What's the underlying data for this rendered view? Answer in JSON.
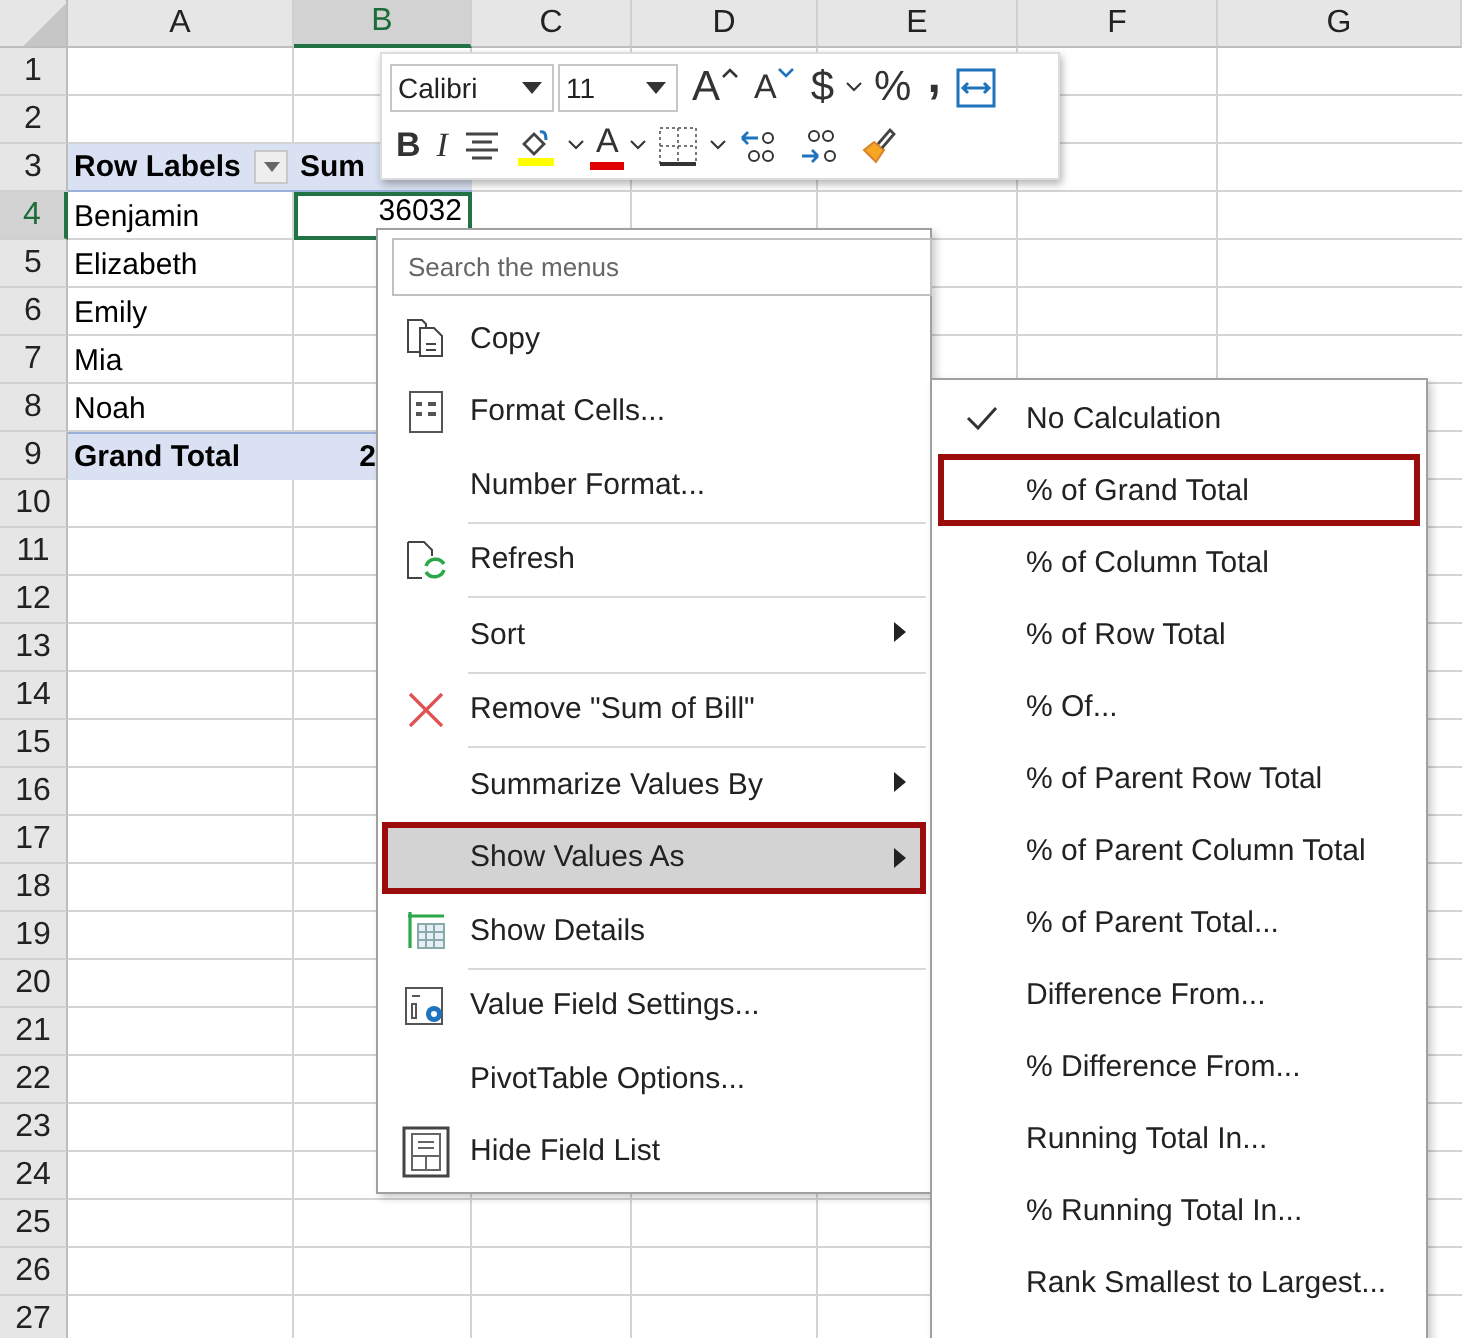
{
  "columns": [
    {
      "label": "A",
      "selected": false
    },
    {
      "label": "B",
      "selected": true
    },
    {
      "label": "C",
      "selected": false
    },
    {
      "label": "D",
      "selected": false
    },
    {
      "label": "E",
      "selected": false
    },
    {
      "label": "F",
      "selected": false
    },
    {
      "label": "G",
      "selected": false
    }
  ],
  "rows": [
    {
      "number": "1",
      "selected": false,
      "kind": "blank"
    },
    {
      "number": "2",
      "selected": false,
      "kind": "blank"
    },
    {
      "number": "3",
      "selected": false,
      "kind": "header",
      "label": "Row Labels",
      "value": "Sum"
    },
    {
      "number": "4",
      "selected": true,
      "kind": "item",
      "label": "Benjamin",
      "value": "36032"
    },
    {
      "number": "5",
      "selected": false,
      "kind": "item",
      "label": "Elizabeth"
    },
    {
      "number": "6",
      "selected": false,
      "kind": "item",
      "label": "Emily"
    },
    {
      "number": "7",
      "selected": false,
      "kind": "item",
      "label": "Mia"
    },
    {
      "number": "8",
      "selected": false,
      "kind": "item",
      "label": "Noah"
    },
    {
      "number": "9",
      "selected": false,
      "kind": "total",
      "label": "Grand Total",
      "value": "2"
    },
    {
      "number": "10",
      "selected": false,
      "kind": "blank"
    },
    {
      "number": "11",
      "selected": false,
      "kind": "blank"
    },
    {
      "number": "12",
      "selected": false,
      "kind": "blank"
    },
    {
      "number": "13",
      "selected": false,
      "kind": "blank"
    },
    {
      "number": "14",
      "selected": false,
      "kind": "blank"
    },
    {
      "number": "15",
      "selected": false,
      "kind": "blank"
    },
    {
      "number": "16",
      "selected": false,
      "kind": "blank"
    },
    {
      "number": "17",
      "selected": false,
      "kind": "blank"
    },
    {
      "number": "18",
      "selected": false,
      "kind": "blank"
    },
    {
      "number": "19",
      "selected": false,
      "kind": "blank"
    },
    {
      "number": "20",
      "selected": false,
      "kind": "blank"
    },
    {
      "number": "21",
      "selected": false,
      "kind": "blank"
    },
    {
      "number": "22",
      "selected": false,
      "kind": "blank"
    },
    {
      "number": "23",
      "selected": false,
      "kind": "blank"
    },
    {
      "number": "24",
      "selected": false,
      "kind": "blank"
    },
    {
      "number": "25",
      "selected": false,
      "kind": "blank"
    },
    {
      "number": "26",
      "selected": false,
      "kind": "blank"
    },
    {
      "number": "27",
      "selected": false,
      "kind": "blank"
    }
  ],
  "mini_toolbar": {
    "font": "Calibri",
    "size": "11",
    "row_1": [
      {
        "kind": "grow",
        "glyph": "A"
      },
      {
        "kind": "shrink",
        "glyph": "A"
      },
      {
        "kind": "currency",
        "glyph": "$"
      },
      {
        "kind": "percent",
        "glyph": "%"
      },
      {
        "kind": "comma",
        "glyph": ","
      },
      {
        "kind": "wrap"
      }
    ],
    "row_2": [
      {
        "kind": "bold",
        "glyph": "B"
      },
      {
        "kind": "italic",
        "glyph": "I"
      },
      {
        "kind": "align"
      },
      {
        "kind": "fill"
      },
      {
        "kind": "fontcolor",
        "glyph": "A"
      },
      {
        "kind": "borders"
      },
      {
        "kind": "increase"
      },
      {
        "kind": "decrease"
      },
      {
        "kind": "painter"
      }
    ]
  },
  "context_menu": {
    "search": {
      "placeholder": "Search the menus"
    },
    "items": [
      {
        "label": "Copy",
        "kind": "copy",
        "divider_before": false,
        "submenu": false,
        "selected": false
      },
      {
        "label": "Format Cells...",
        "kind": "format",
        "divider_before": false,
        "submenu": false,
        "selected": false
      },
      {
        "label": "Number Format...",
        "kind": "none",
        "divider_before": false,
        "submenu": false,
        "selected": false
      },
      {
        "label": "Refresh",
        "kind": "refresh",
        "divider_before": true,
        "submenu": false,
        "selected": false
      },
      {
        "label": "Sort",
        "kind": "none",
        "divider_before": true,
        "submenu": true,
        "selected": false
      },
      {
        "label": "Remove \"Sum of Bill\"",
        "kind": "remove",
        "divider_before": true,
        "submenu": false,
        "selected": false
      },
      {
        "label": "Summarize Values By",
        "kind": "none",
        "divider_before": true,
        "submenu": true,
        "selected": false
      },
      {
        "label": "Show Values As",
        "kind": "none",
        "divider_before": false,
        "submenu": true,
        "selected": true
      },
      {
        "label": "Show Details",
        "kind": "details",
        "divider_before": false,
        "submenu": false,
        "selected": false
      },
      {
        "label": "Value Field Settings...",
        "kind": "settings",
        "divider_before": true,
        "submenu": false,
        "selected": false
      },
      {
        "label": "PivotTable Options...",
        "kind": "none",
        "divider_before": false,
        "submenu": false,
        "selected": false
      },
      {
        "label": "Hide Field List",
        "kind": "fieldlist",
        "divider_before": false,
        "submenu": false,
        "selected": false
      }
    ]
  },
  "submenu": {
    "items": [
      {
        "label": "No Calculation",
        "checked": true,
        "selected": false
      },
      {
        "label": "% of Grand Total",
        "checked": false,
        "selected": true
      },
      {
        "label": "% of Column Total",
        "checked": false,
        "selected": false
      },
      {
        "label": "% of Row Total",
        "checked": false,
        "selected": false
      },
      {
        "label": "% Of...",
        "checked": false,
        "selected": false
      },
      {
        "label": "% of Parent Row Total",
        "checked": false,
        "selected": false
      },
      {
        "label": "% of Parent Column Total",
        "checked": false,
        "selected": false
      },
      {
        "label": "% of Parent Total...",
        "checked": false,
        "selected": false
      },
      {
        "label": "Difference From...",
        "checked": false,
        "selected": false
      },
      {
        "label": "% Difference From...",
        "checked": false,
        "selected": false
      },
      {
        "label": "Running Total In...",
        "checked": false,
        "selected": false
      },
      {
        "label": "% Running Total In...",
        "checked": false,
        "selected": false
      },
      {
        "label": "Rank Smallest to Largest...",
        "checked": false,
        "selected": false
      }
    ]
  }
}
